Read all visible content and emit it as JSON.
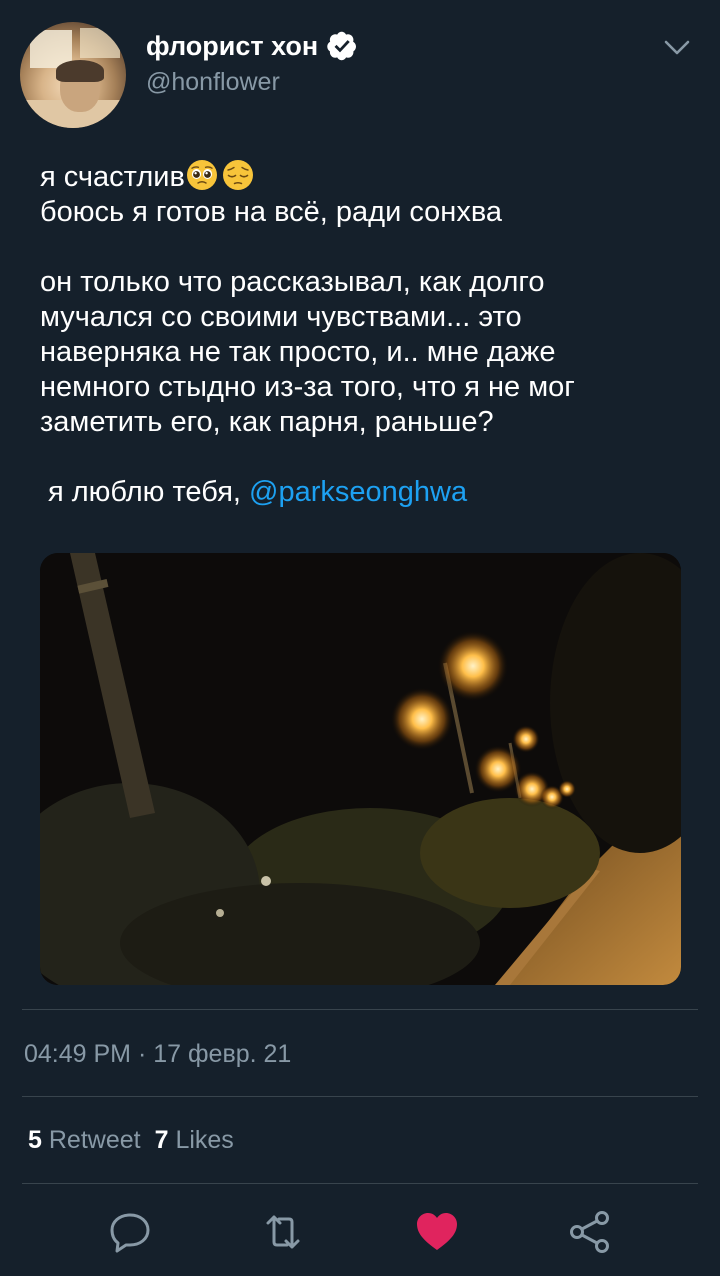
{
  "user": {
    "display_name": "флорист хон",
    "handle": "@honflower",
    "verified": true
  },
  "tweet": {
    "line1": "я счастлив",
    "line1_emojis": [
      "pleading-face-emoji",
      "pensive-face-emoji"
    ],
    "line2": "боюсь я готов на всё, ради сонхва",
    "paragraph2": "он только что рассказывал, как долго\nмучался со своими чувствами... это\nнаверняка не так просто, и.. мне даже\nнемного стыдно из-за того, что я не мог\nзаметить его, как парня, раньше?",
    "last_line_text": "я люблю тебя, ",
    "mention": "@parkseonghwa",
    "media_description_icon": "night-street-lamps-photo"
  },
  "meta": {
    "timestamp": "04:49 PM · 17 февр. 21"
  },
  "stats": {
    "retweets_count": "5",
    "retweets_label": "Retweet",
    "likes_count": "7",
    "likes_label": "Likes"
  },
  "actions": [
    "reply-icon",
    "retweet-icon",
    "like-icon",
    "share-icon"
  ],
  "colors": {
    "background": "#15202b",
    "text": "#ffffff",
    "secondary": "#8899a6",
    "link": "#1da1f2",
    "like": "#e0245e",
    "divider": "#38444d"
  }
}
